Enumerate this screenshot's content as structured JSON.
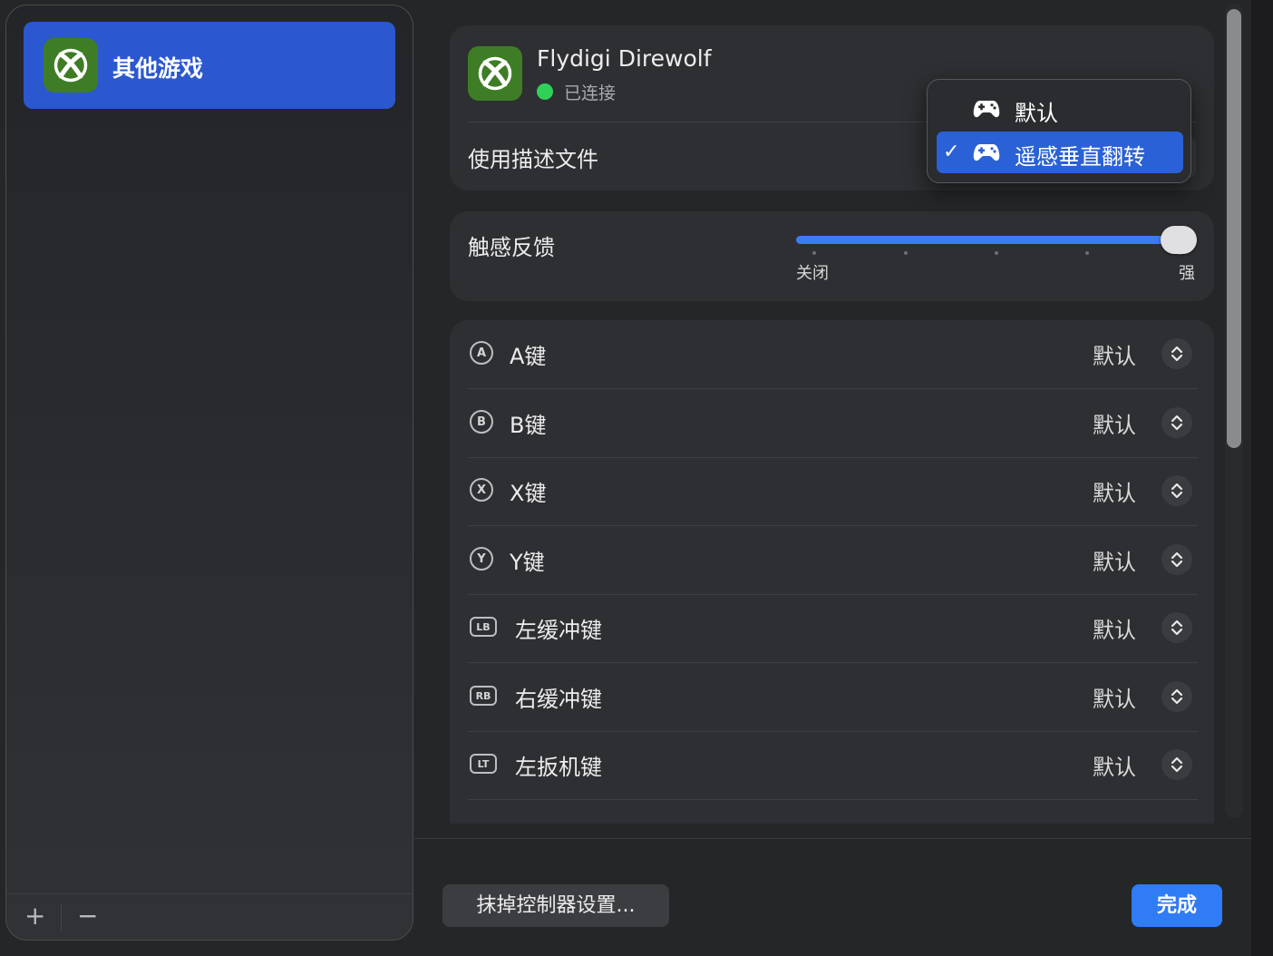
{
  "sidebar": {
    "items": [
      {
        "label": "其他游戏",
        "icon": "xbox-icon"
      }
    ],
    "footer": {
      "add": "+",
      "remove": "−"
    }
  },
  "device": {
    "name": "Flydigi Direwolf",
    "status": "已连接",
    "profile_label": "使用描述文件",
    "status_color": "#30d158"
  },
  "haptics": {
    "label": "触感反馈",
    "min_label": "关闭",
    "max_label": "强",
    "level": 1.0
  },
  "buttons": [
    {
      "glyph": "A",
      "label": "A键",
      "value": "默认"
    },
    {
      "glyph": "B",
      "label": "B键",
      "value": "默认"
    },
    {
      "glyph": "X",
      "label": "X键",
      "value": "默认"
    },
    {
      "glyph": "Y",
      "label": "Y键",
      "value": "默认"
    },
    {
      "glyph": "LB",
      "label": "左缓冲键",
      "value": "默认"
    },
    {
      "glyph": "RB",
      "label": "右缓冲键",
      "value": "默认"
    },
    {
      "glyph": "LT",
      "label": "左扳机键",
      "value": "默认"
    }
  ],
  "footer": {
    "wipe_button": "抹掉控制器设置...",
    "done_button": "完成"
  },
  "profile_menu": {
    "options": [
      {
        "label": "默认",
        "checked": false
      },
      {
        "label": "遥感垂直翻转",
        "checked": true
      }
    ],
    "check_mark": "✓"
  },
  "colors": {
    "accent": "#2f7cf6",
    "selection": "#2b58cf",
    "icon_green": "#3e7d25"
  }
}
